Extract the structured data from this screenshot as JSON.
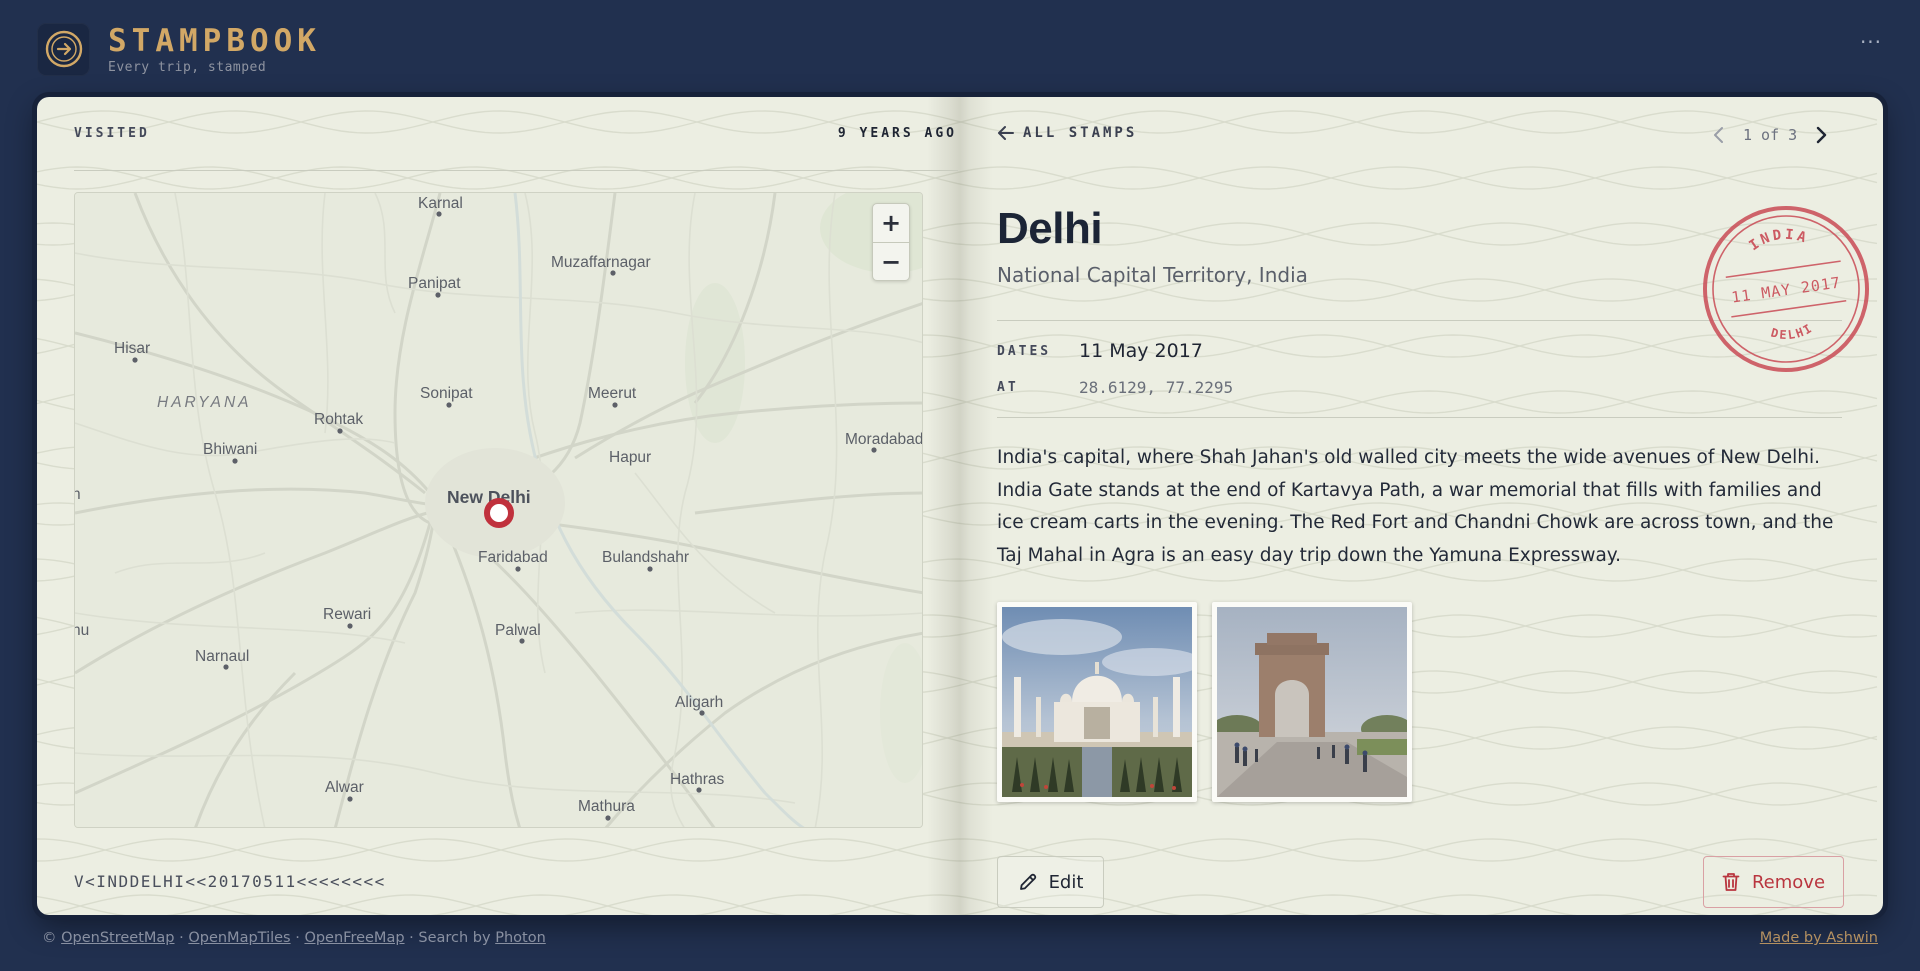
{
  "app": {
    "title": "STAMPBOOK",
    "tagline": "Every trip, stamped",
    "more_icon": "more-icon",
    "more_label": "···"
  },
  "left_page": {
    "visited_label": "VISITED",
    "ago_label": "9 YEARS AGO",
    "mrz": "V<INDDELHI<<20170511<<<<<<<<",
    "map": {
      "zoom_in": "+",
      "zoom_out": "−",
      "region_label": "HARYANA",
      "cities": [
        "Karnal",
        "Muzaffarnagar",
        "Panipat",
        "Hisar",
        "Sonipat",
        "Meerut",
        "Rohtak",
        "Bhiwani",
        "Moradabad",
        "Hapur",
        "New Delhi",
        "Faridabad",
        "Bulandshahr",
        "Rewari",
        "Palwal",
        "Narnaul",
        "Aligarh",
        "Hathras",
        "Alwar",
        "Mathura",
        "nu",
        "n"
      ],
      "marker_color": "#c0313d"
    }
  },
  "right_page": {
    "back_label": "ALL STAMPS",
    "pager": "1 of 3",
    "place": "Delhi",
    "region": "National Capital Territory, India",
    "dates_label": "DATES",
    "dates_value": "11 May 2017",
    "at_label": "AT",
    "at_value": "28.6129, 77.2295",
    "description": "India's capital, where Shah Jahan's old walled city meets the wide avenues of New Delhi. India Gate stands at the end of Kartavyа Path, a war memorial that fills with families and ice cream carts in the evening. The Red Fort and Chandni Chowk are across town, and the Taj Mahal in Agra is an easy day trip down the Yamuna Expressway.",
    "stamp": {
      "country": "INDIA",
      "date": "11 MAY 2017",
      "city": "DELHI",
      "color": "#c94a55"
    },
    "photos": [
      "taj-mahal-photo",
      "india-gate-photo"
    ],
    "edit_label": "Edit",
    "remove_label": "Remove"
  },
  "footer": {
    "copyright": "©",
    "links": [
      "OpenStreetMap",
      "OpenMapTiles",
      "OpenFreeMap"
    ],
    "search_prefix": "· Search by",
    "search_link": "Photon",
    "made_by": "Made by Ashwin"
  },
  "colors": {
    "background": "#21304f",
    "brand": "#d2a866",
    "paper": "#eceee2",
    "danger": "#b9353f"
  }
}
